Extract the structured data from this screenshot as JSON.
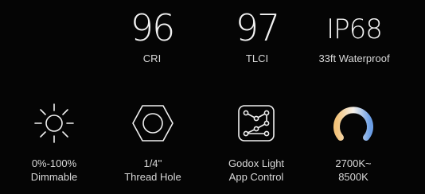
{
  "specs": {
    "cri": {
      "value": "96",
      "label": "CRI"
    },
    "tlci": {
      "value": "97",
      "label": "TLCI"
    },
    "ip": {
      "value": "IP68",
      "label": "33ft Waterproof"
    }
  },
  "features": {
    "dimming": {
      "line1": "0%-100%",
      "line2": "Dimmable",
      "icon": "sun-icon"
    },
    "thread": {
      "line1": "1/4''",
      "line2": "Thread Hole",
      "icon": "hexagon-nut-icon"
    },
    "app": {
      "line1": "Godox Light",
      "line2": "App Control",
      "icon": "app-grid-icon"
    },
    "cct": {
      "line1": "2700K~",
      "line2": "8500K",
      "icon": "color-temperature-ring-icon"
    }
  },
  "colors": {
    "background": "#050505",
    "text": "#e9e9e9",
    "warm": "#f3c37a",
    "cool": "#6c9fe6"
  }
}
